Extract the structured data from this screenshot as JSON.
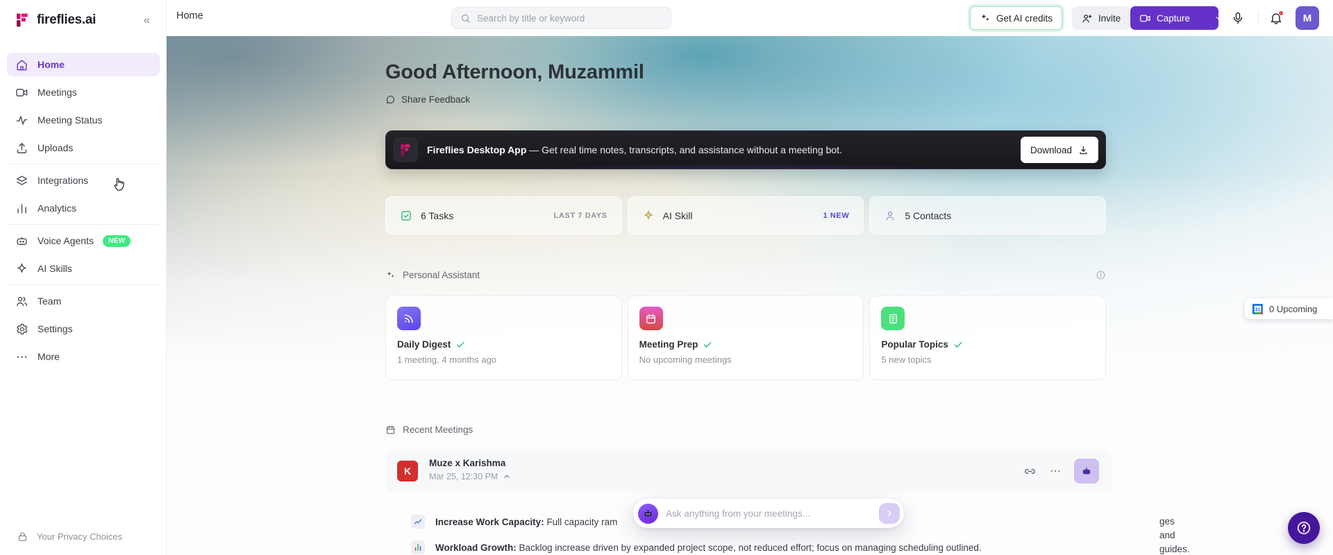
{
  "colors": {
    "accent_purple": "#6432c8",
    "active_nav_purple": "#6a35cc",
    "badge_green": "#3fe982",
    "credits_border_mint": "#9fe3c0",
    "avatar_purple": "#6a59cf",
    "meeting_avatar_red": "#d22f2f",
    "check_green": "#34b87c",
    "meta_purple": "#5646d6",
    "help_fab_purple": "#46169c",
    "banner_bg": "#1a1a20"
  },
  "sidebar": {
    "logo_text": "fireflies.ai",
    "collapse_icon": "«",
    "nav": [
      {
        "label": "Home",
        "icon": "home-icon",
        "active": true
      },
      {
        "label": "Meetings",
        "icon": "video-camera-icon"
      },
      {
        "label": "Meeting Status",
        "icon": "pulse-icon"
      },
      {
        "label": "Uploads",
        "icon": "upload-icon"
      },
      {
        "label": "Integrations",
        "icon": "layers-icon"
      },
      {
        "label": "Analytics",
        "icon": "bar-chart-icon"
      },
      {
        "label": "Voice Agents",
        "icon": "robot-icon",
        "badge": "NEW"
      },
      {
        "label": "AI Skills",
        "icon": "sparkle-icon"
      },
      {
        "label": "Team",
        "icon": "people-icon"
      },
      {
        "label": "Settings",
        "icon": "gear-icon"
      },
      {
        "label": "More",
        "icon": "ellipsis-icon"
      }
    ],
    "privacy_label": "Your Privacy Choices"
  },
  "topbar": {
    "page_title": "Home",
    "search_placeholder": "Search by title or keyword",
    "get_credits_label": "Get AI credits",
    "invite_label": "Invite",
    "capture_label": "Capture",
    "avatar_initial": "M"
  },
  "hero": {
    "greeting": "Good Afternoon, Muzammil",
    "share_feedback_label": "Share Feedback"
  },
  "banner": {
    "title": "Fireflies Desktop App",
    "message": "— Get real time notes, transcripts, and assistance without a meeting bot.",
    "download_label": "Download"
  },
  "stats": {
    "tasks": {
      "label": "6 Tasks",
      "meta": "LAST 7 DAYS",
      "icon": "checkbox-icon"
    },
    "ai_skill": {
      "label": "AI Skill",
      "meta": "1 NEW",
      "icon": "sparkle-icon"
    },
    "contacts": {
      "label": "5 Contacts",
      "icon": "person-icon"
    }
  },
  "assistant": {
    "title": "Personal Assistant",
    "cards": [
      {
        "title": "Daily Digest",
        "subtitle": "1 meeting, 4 months ago",
        "icon": "rss-icon",
        "color": "#6a53ee"
      },
      {
        "title": "Meeting Prep",
        "subtitle": "No upcoming meetings",
        "icon": "calendar-icon",
        "color": "#db50a0"
      },
      {
        "title": "Popular Topics",
        "subtitle": "5 new topics",
        "icon": "notebook-icon",
        "color": "#4be07c"
      }
    ]
  },
  "upcoming_tab": {
    "label": "0 Upcoming",
    "icon": "google-calendar-icon"
  },
  "recent": {
    "title": "Recent Meetings",
    "meeting": {
      "avatar_initial": "K",
      "title": "Muze x Karishma",
      "datetime": "Mar 25, 12:30 PM"
    },
    "notes": [
      {
        "label": "Increase Work Capacity:",
        "text_left": " Full capacity ram",
        "text_right": "ges and guides.",
        "icon": "line-chart-icon"
      },
      {
        "label": "Workload Growth:",
        "text": " Backlog increase driven by expanded project scope, not reduced effort; focus on managing scheduling outlined.",
        "icon": "bar-chart-icon"
      }
    ]
  },
  "askbar": {
    "placeholder": "Ask anything from your meetings..."
  }
}
